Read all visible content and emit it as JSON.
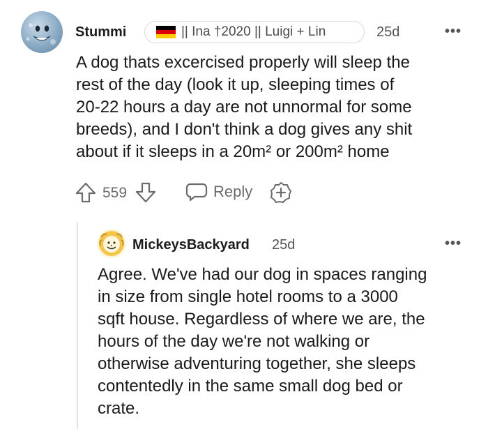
{
  "comment": {
    "username": "Stummi",
    "flair_text": "|| Ina †2020 || Luigi + Lin",
    "age": "25d",
    "body_lines": [
      "A dog thats excercised properly will sleep the",
      "rest of the day (look it up, sleeping times of",
      "20-22 hours a day are not unnormal for some",
      "breeds), and I don't think a dog gives any shit",
      "about if it sleeps in a 20m² or 200m² home"
    ],
    "vote_count": "559",
    "reply_label": "Reply",
    "more_label": "•••",
    "icons": [
      "upvote-icon",
      "downvote-icon",
      "reply-icon",
      "award-icon",
      "more-options-icon"
    ]
  },
  "reply": {
    "username": "MickeysBackyard",
    "age": "25d",
    "more_label": "•••",
    "body_lines": [
      "Agree. We've had our dog in spaces ranging",
      "in size from single hotel rooms to a 3000",
      "sqft house. Regardless of where we are, the",
      "hours of the day we're not walking or",
      "otherwise adventuring together, she sleeps",
      "contentedly in the same small dog bed or",
      "crate."
    ]
  },
  "colors": {
    "text": "#1a1a1b",
    "meta": "#555555",
    "action": "#6b6b6b",
    "thread_line": "#e4e4e4",
    "flag_black": "#000000",
    "flag_red": "#dd0000",
    "flag_gold": "#ffce00"
  }
}
